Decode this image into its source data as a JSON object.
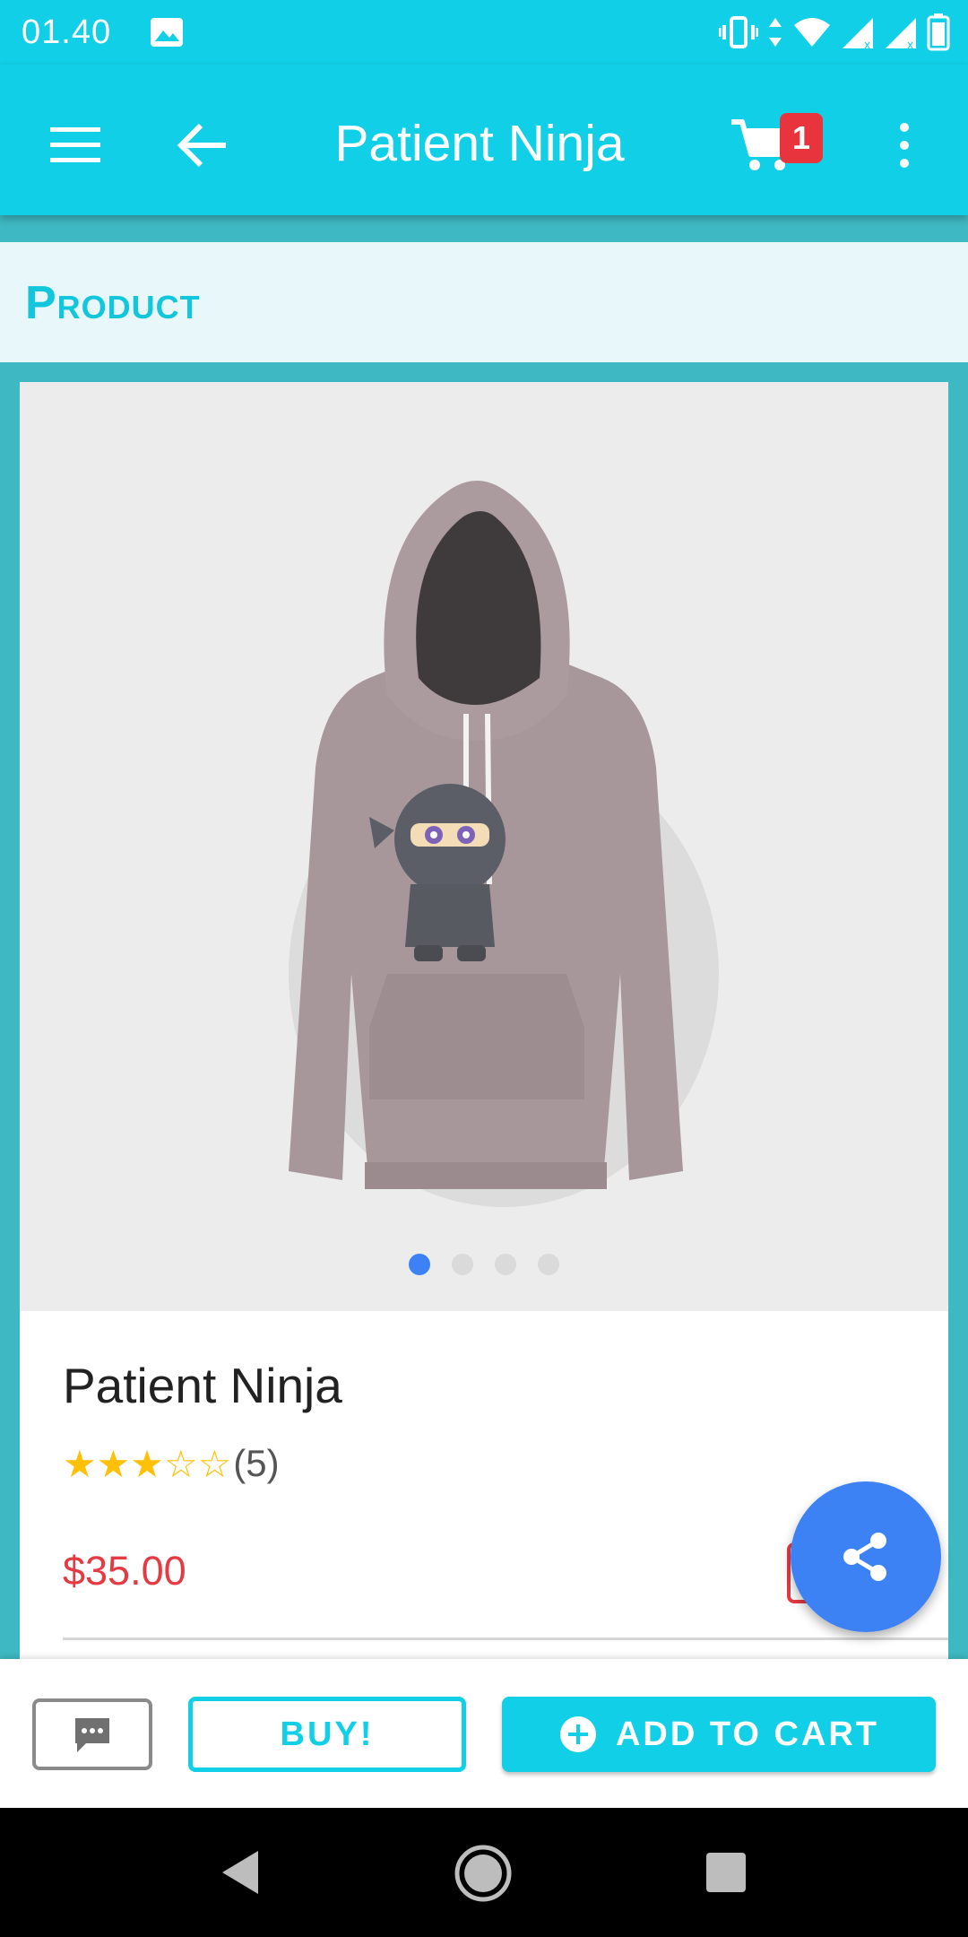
{
  "status_bar": {
    "time": "01.40"
  },
  "app_bar": {
    "title": "Patient Ninja",
    "cart_count": "1"
  },
  "section": {
    "title": "Product"
  },
  "product": {
    "name": "Patient Ninja",
    "rating_value": 3,
    "rating_max": 5,
    "stars_filled": "★★★",
    "stars_empty": "☆☆",
    "review_count": "(5)",
    "price": "$35.00",
    "image_count": 4,
    "active_image_index": 0
  },
  "actions": {
    "buy_label": "BUY!",
    "add_to_cart_label": "ADD TO CART"
  },
  "icons": {
    "menu": "menu-icon",
    "back": "arrow-left-icon",
    "cart": "cart-icon",
    "overflow": "more-vert-icon",
    "share": "share-icon",
    "chat": "chat-icon",
    "add": "plus-circle-icon"
  },
  "colors": {
    "primary": "#11cfe6",
    "accent_blue": "#3d82f5",
    "price_red": "#e53a42",
    "star_yellow": "#ffc107",
    "badge_red": "#e8343c"
  }
}
